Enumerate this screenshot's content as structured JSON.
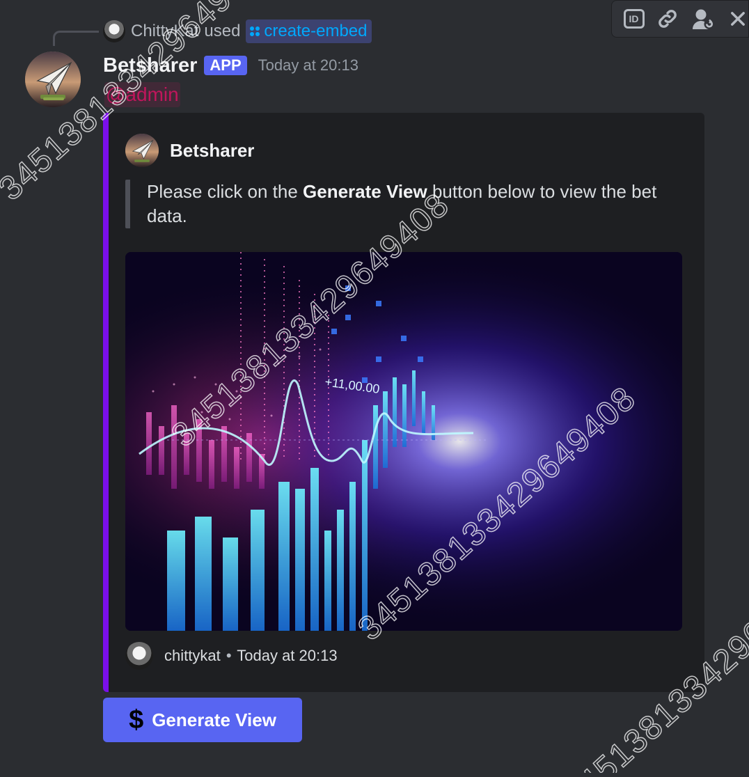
{
  "reply": {
    "user": "ChittyKat",
    "action": "used",
    "command": "create-embed"
  },
  "message": {
    "author": "Betsharer",
    "tag": "APP",
    "timestamp": "Today at 20:13",
    "mention": "@admin"
  },
  "embed": {
    "accent_color": "#7a0fea",
    "author_name": "Betsharer",
    "description_before": "Please click on the ",
    "description_bold": "Generate View",
    "description_after": " button below to view the bet data.",
    "image_alt_text": "+11,00.00",
    "footer_user": "chittykat",
    "footer_separator": "•",
    "footer_time": "Today at 20:13"
  },
  "button": {
    "label": "Generate View",
    "icon": "dollar-icon",
    "icon_glyph": "$"
  },
  "toolbar": {
    "copy_id_label": "ID",
    "icons": [
      "id-icon",
      "link-icon",
      "message-avatar-icon",
      "close-icon"
    ]
  },
  "watermark_text": "3451381334296494",
  "watermark_text_2": "345138133429649408"
}
